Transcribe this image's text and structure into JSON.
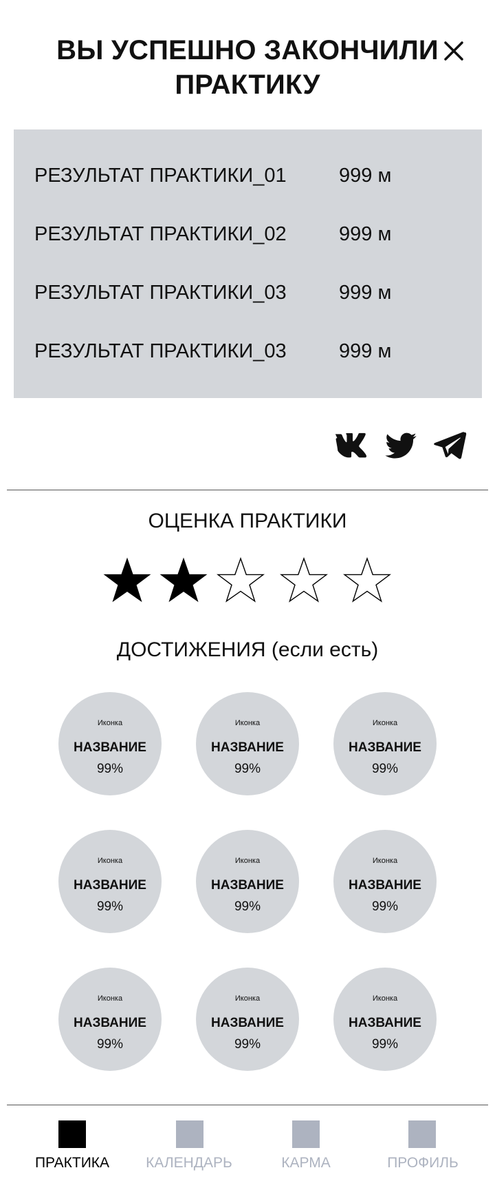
{
  "header": {
    "title_line1": "ВЫ УСПЕШНО ЗАКОНЧИЛИ",
    "title_line2": "ПРАКТИКУ",
    "close_icon": "close-icon"
  },
  "results": [
    {
      "label": "РЕЗУЛЬТАТ ПРАКТИКИ_01",
      "value": "999 м"
    },
    {
      "label": "РЕЗУЛЬТАТ ПРАКТИКИ_02",
      "value": "999 м"
    },
    {
      "label": "РЕЗУЛЬТАТ ПРАКТИКИ_03",
      "value": "999 м"
    },
    {
      "label": "РЕЗУЛЬТАТ ПРАКТИКИ_03",
      "value": "999 м"
    }
  ],
  "share": {
    "icons": [
      "vk-icon",
      "twitter-icon",
      "telegram-icon"
    ]
  },
  "rating": {
    "title": "ОЦЕНКА ПРАКТИКИ",
    "value": 2,
    "max": 5
  },
  "achievements": {
    "title": "ДОСТИЖЕНИЯ (если есть)",
    "items": [
      {
        "icon_label": "Иконка",
        "name": "НАЗВАНИЕ",
        "percent": "99%"
      },
      {
        "icon_label": "Иконка",
        "name": "НАЗВАНИЕ",
        "percent": "99%"
      },
      {
        "icon_label": "Иконка",
        "name": "НАЗВАНИЕ",
        "percent": "99%"
      },
      {
        "icon_label": "Иконка",
        "name": "НАЗВАНИЕ",
        "percent": "99%"
      },
      {
        "icon_label": "Иконка",
        "name": "НАЗВАНИЕ",
        "percent": "99%"
      },
      {
        "icon_label": "Иконка",
        "name": "НАЗВАНИЕ",
        "percent": "99%"
      },
      {
        "icon_label": "Иконка",
        "name": "НАЗВАНИЕ",
        "percent": "99%"
      },
      {
        "icon_label": "Иконка",
        "name": "НАЗВАНИЕ",
        "percent": "99%"
      },
      {
        "icon_label": "Иконка",
        "name": "НАЗВАНИЕ",
        "percent": "99%"
      }
    ]
  },
  "tabbar": {
    "tabs": [
      {
        "label": "ПРАКТИКА",
        "active": true
      },
      {
        "label": "КАЛЕНДАРЬ",
        "active": false
      },
      {
        "label": "КАРМА",
        "active": false
      },
      {
        "label": "ПРОФИЛЬ",
        "active": false
      }
    ]
  },
  "colors": {
    "panel": "#d3d6da",
    "tab_active": "#000000",
    "tab_inactive": "#adb3c0",
    "tab_inactive_text": "#adb3c0"
  }
}
